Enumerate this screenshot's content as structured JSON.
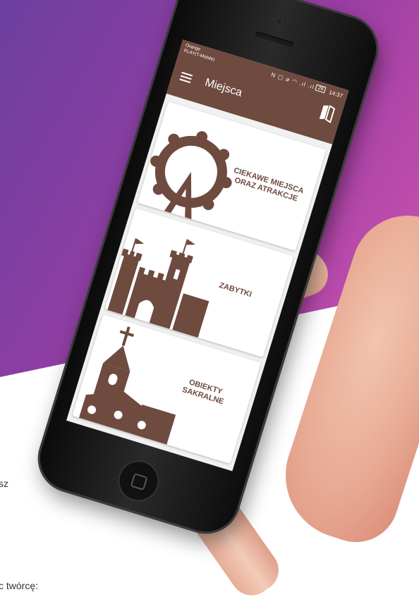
{
  "colors": {
    "brand_brown": "#6e4a3f",
    "bg_purple_start": "#6b3fa0",
    "bg_purple_end": "#c64fae"
  },
  "side_texts": [
    "sz",
    "c twórcę:"
  ],
  "phone": {
    "status": {
      "carrier_line1": "Orange",
      "carrier_line2": "PLAY(T-Mobile)",
      "icons": "N ▢ ⌀ ◠ .ıl .ıl",
      "battery": "28",
      "time": "14:37"
    },
    "appbar": {
      "title": "Miejsca",
      "menu_icon": "hamburger-menu-icon",
      "action_icon": "map-icon"
    },
    "cards": [
      {
        "label_line1": "CIEKAWE MIEJSCA",
        "label_line2": "ORAZ ATRAKCJE",
        "icon": "ferris-wheel-icon"
      },
      {
        "label_line1": "ZABYTKI",
        "label_line2": "",
        "icon": "castle-icon"
      },
      {
        "label_line1": "OBIEKTY SAKRALNE",
        "label_line2": "",
        "icon": "church-icon"
      }
    ]
  }
}
